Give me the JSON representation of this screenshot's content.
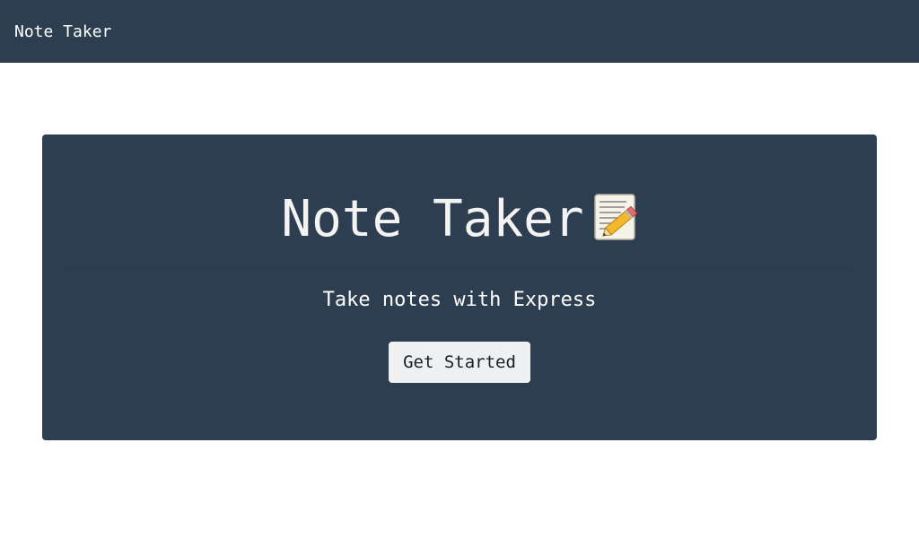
{
  "navbar": {
    "brand": "Note Taker"
  },
  "hero": {
    "title": "Note Taker",
    "title_icon": "memo-pencil-icon",
    "lead": "Take notes with Express",
    "button_label": "Get Started"
  },
  "colors": {
    "navbar_bg": "#2d3e50",
    "hero_bg": "#2d3e50",
    "button_bg": "#eef0f1",
    "page_bg": "#ffffff"
  }
}
